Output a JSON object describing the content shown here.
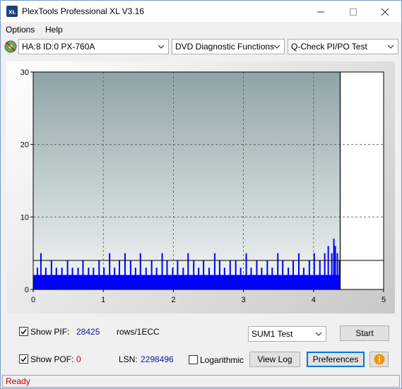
{
  "window": {
    "title": "PlexTools Professional XL V3.16",
    "icon_text": "XL"
  },
  "menu": {
    "options": "Options",
    "help": "Help"
  },
  "toolbar": {
    "drive": "HA:8 ID:0  PX-760A",
    "function": "DVD Diagnostic Functions",
    "test": "Q-Check PI/PO Test"
  },
  "chart_data": {
    "type": "bar",
    "title": "",
    "xlabel": "",
    "ylabel": "",
    "xlim": [
      0,
      5
    ],
    "ylim": [
      0,
      30
    ],
    "x_ticks": [
      "0",
      "1",
      "2",
      "3",
      "4",
      "5"
    ],
    "y_ticks": [
      "0",
      "10",
      "20",
      "30"
    ],
    "grid": true,
    "end_marker_x": 4.38,
    "threshold_y": 4,
    "series": [
      {
        "color": "#0000ff",
        "base_level": 2,
        "x": [
          0.05,
          0.1,
          0.17,
          0.25,
          0.32,
          0.4,
          0.48,
          0.55,
          0.63,
          0.7,
          0.78,
          0.85,
          0.93,
          1.0,
          1.08,
          1.15,
          1.22,
          1.3,
          1.38,
          1.45,
          1.52,
          1.6,
          1.68,
          1.75,
          1.83,
          1.9,
          1.98,
          2.05,
          2.13,
          2.2,
          2.28,
          2.35,
          2.42,
          2.5,
          2.58,
          2.65,
          2.72,
          2.8,
          2.88,
          2.95,
          3.03,
          3.1,
          3.18,
          3.25,
          3.33,
          3.4,
          3.48,
          3.55,
          3.63,
          3.7,
          3.78,
          3.85,
          3.93,
          4.0,
          4.08,
          4.15,
          4.2,
          4.25,
          4.28,
          4.3,
          4.33,
          4.36
        ],
        "values": [
          3,
          5,
          3,
          4,
          3,
          3,
          4,
          3,
          3,
          4,
          3,
          3,
          4,
          3,
          5,
          3,
          4,
          5,
          4,
          3,
          5,
          3,
          4,
          3,
          5,
          4,
          3,
          4,
          3,
          5,
          4,
          3,
          4,
          3,
          5,
          4,
          3,
          4,
          4,
          3,
          5,
          3,
          4,
          3,
          4,
          3,
          5,
          4,
          3,
          4,
          5,
          3,
          4,
          5,
          4,
          5,
          6,
          5,
          7,
          6,
          5,
          4
        ]
      }
    ]
  },
  "panel": {
    "show_pif_label": "Show PIF:",
    "pif_value": "28425",
    "pif_unit": "rows/1ECC",
    "show_pof_label": "Show POF:",
    "pof_value": "0",
    "lsn_label": "LSN:",
    "lsn_value": "2298496",
    "logarithmic_label": "Logarithmic",
    "test_select": "SUM1 Test",
    "start_button": "Start",
    "view_log_button": "View Log",
    "preferences_button": "Preferences"
  },
  "status": {
    "text": "Ready"
  }
}
